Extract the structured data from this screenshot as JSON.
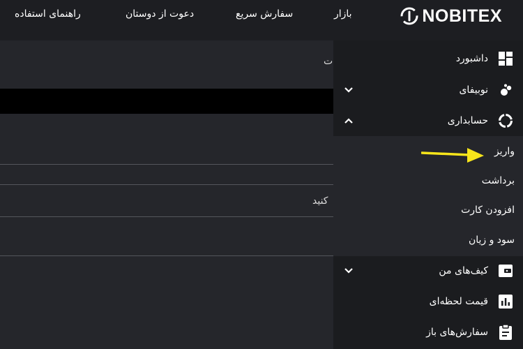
{
  "header": {
    "logo_text": "NOBITEX",
    "nav": [
      "بازار",
      "سفارش سریع",
      "دعوت از دوستان",
      "راهنمای استفاده"
    ]
  },
  "main": {
    "title_fragment": "ت",
    "hint_fragment": "کنید"
  },
  "sidebar": {
    "items": [
      {
        "label": "داشبورد",
        "icon": "dashboard-icon"
      },
      {
        "label": "نوبیفای",
        "icon": "nobify-icon",
        "chevron": "down"
      },
      {
        "label": "حسابداری",
        "icon": "accounting-icon",
        "chevron": "up"
      }
    ],
    "submenu": [
      "واریز",
      "برداشت",
      "افزودن کارت",
      "سود و زیان"
    ],
    "items2": [
      {
        "label": "کیف‌های من",
        "icon": "wallet-icon",
        "chevron": "down"
      },
      {
        "label": "قیمت لحظه‌ای",
        "icon": "price-chart-icon"
      },
      {
        "label": "سفارش‌های باز",
        "icon": "clipboard-icon"
      }
    ]
  },
  "colors": {
    "header_bg": "#1d1e22",
    "sidebar_bg": "#1b1c1f",
    "content_bg": "#25262b",
    "arrow": "#f7e51b"
  }
}
